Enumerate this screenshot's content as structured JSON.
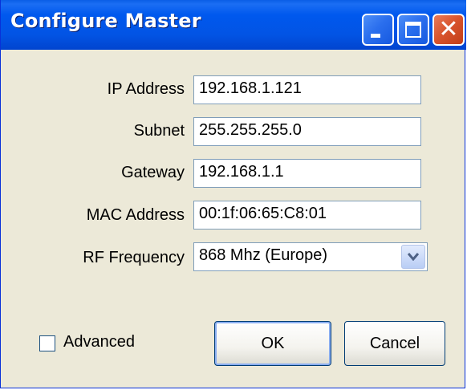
{
  "window": {
    "title": "Configure Master"
  },
  "titlebar_buttons": [
    {
      "name": "minimize-button",
      "icon": "minimize-icon"
    },
    {
      "name": "maximize-button",
      "icon": "maximize-icon"
    },
    {
      "name": "close-button",
      "icon": "close-icon",
      "glyph": "✕"
    }
  ],
  "form": {
    "ip": {
      "label": "IP Address",
      "value": "192.168.1.121"
    },
    "subnet": {
      "label": "Subnet",
      "value": "255.255.255.0"
    },
    "gateway": {
      "label": "Gateway",
      "value": "192.168.1.1"
    },
    "mac": {
      "label": "MAC Address",
      "value": "00:1f:06:65:C8:01"
    },
    "rf": {
      "label": "RF Frequency",
      "value": "868 Mhz (Europe)"
    }
  },
  "advanced": {
    "label": "Advanced",
    "checked": false
  },
  "buttons": {
    "ok": "OK",
    "cancel": "Cancel"
  },
  "colors": {
    "titlebar": "#0058ee",
    "close_button": "#d9552e",
    "window_bg": "#ece9d8",
    "field_border": "#7f9db9"
  }
}
